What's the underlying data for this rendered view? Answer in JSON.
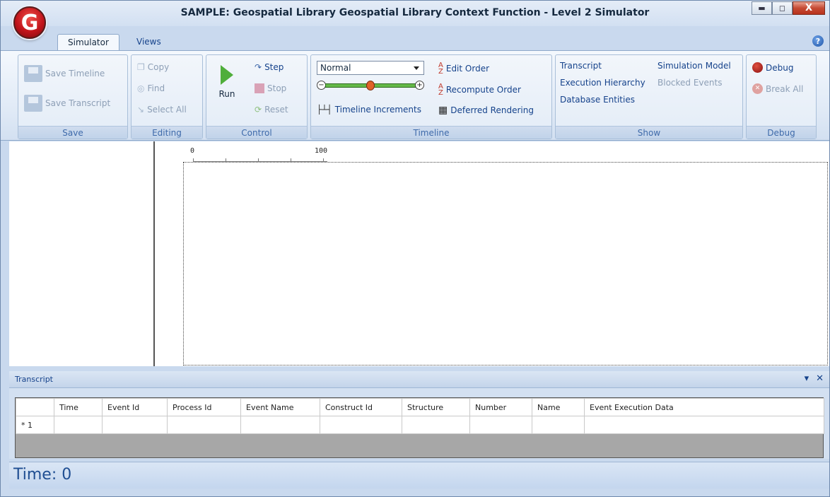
{
  "window": {
    "title": "SAMPLE: Geospatial Library Geospatial Library Context Function - Level 2 Simulator",
    "app_icon": "G"
  },
  "tabs": [
    {
      "label": "Simulator",
      "active": true
    },
    {
      "label": "Views",
      "active": false
    }
  ],
  "ribbon": {
    "save": {
      "label": "Save",
      "save_timeline": "Save Timeline",
      "save_transcript": "Save Transcript"
    },
    "editing": {
      "label": "Editing",
      "copy": "Copy",
      "find": "Find",
      "select_all": "Select All"
    },
    "control": {
      "label": "Control",
      "run": "Run",
      "step": "Step",
      "stop": "Stop",
      "reset": "Reset"
    },
    "timeline": {
      "label": "Timeline",
      "speed_value": "Normal",
      "speed_level": 0.5,
      "timeline_increments": "Timeline Increments",
      "edit_order": "Edit Order",
      "recompute_order": "Recompute Order",
      "deferred_rendering": "Deferred Rendering"
    },
    "show": {
      "label": "Show",
      "transcript": "Transcript",
      "execution_hierarchy": "Execution Hierarchy",
      "database_entities": "Database Entities",
      "simulation_model": "Simulation Model",
      "blocked_events": "Blocked Events"
    },
    "debug": {
      "label": "Debug",
      "debug": "Debug",
      "break_all": "Break All"
    }
  },
  "ruler": {
    "start": "0",
    "end": "100"
  },
  "transcript": {
    "title": "Transcript",
    "columns": [
      "Time",
      "Event Id",
      "Process Id",
      "Event Name",
      "Construct Id",
      "Structure",
      "Number",
      "Name",
      "Event Execution Data"
    ],
    "rows": [
      {
        "marker": "* 1",
        "cells": [
          "",
          "",
          "",
          "",
          "",
          "",
          "",
          "",
          ""
        ]
      }
    ]
  },
  "status": {
    "time_text": "Time: 0"
  }
}
